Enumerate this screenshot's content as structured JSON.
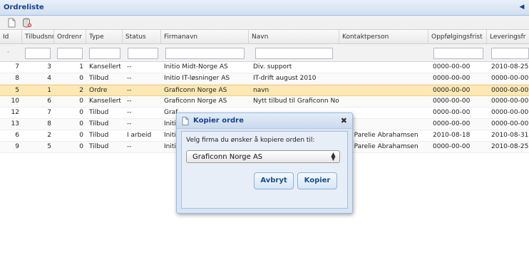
{
  "panel": {
    "title": "Ordreliste",
    "collapse_icon": "chevron-left-icon"
  },
  "toolbar": {
    "icons": [
      "new-document-icon",
      "delete-database-icon"
    ]
  },
  "grid": {
    "columns": [
      "Id",
      "Tilbudsnr",
      "Ordrenr",
      "Type",
      "Status",
      "Firmanavn",
      "Navn",
      "Kontaktperson",
      "Oppfølgingsfrist",
      "Leveringsfr"
    ],
    "filter_placeholder": "-",
    "rows": [
      [
        "7",
        "3",
        "1",
        "Kansellert",
        "--",
        "Initio Midt-Norge AS",
        "Div. support",
        "",
        "0000-00-00",
        "2010-08-25"
      ],
      [
        "8",
        "4",
        "0",
        "Tilbud",
        "--",
        "Initio IT-løsninger AS",
        "IT-drift august 2010",
        "",
        "0000-00-00",
        "0000-00-00"
      ],
      [
        "5",
        "1",
        "2",
        "Ordre",
        "--",
        "Graficonn Norge AS",
        "navn",
        "",
        "0000-00-00",
        "0000-00-00"
      ],
      [
        "10",
        "6",
        "0",
        "Kansellert",
        "--",
        "Graficonn Norge AS",
        "Nytt tilbud til Graficonn Norge",
        "",
        "0000-00-00",
        "0000-00-00"
      ],
      [
        "12",
        "7",
        "0",
        "Tilbud",
        "--",
        "Graf",
        "",
        "",
        "0000-00-00",
        "0000-00-00"
      ],
      [
        "13",
        "8",
        "0",
        "Tilbud",
        "--",
        "Initi",
        "",
        "",
        "0000-00-00",
        "0000-00-00"
      ],
      [
        "6",
        "2",
        "0",
        "Tilbud",
        "I arbeid",
        "Initi",
        "",
        "ith Parelie Abrahamsen",
        "2010-08-18",
        "2010-08-31"
      ],
      [
        "9",
        "5",
        "0",
        "Tilbud",
        "--",
        "Initi",
        "",
        "ith Parelie Abrahamsen",
        "0000-00-00",
        "2010-08-25"
      ]
    ],
    "selected_row": 2
  },
  "dialog": {
    "title": "Kopier ordre",
    "close_label": "✖",
    "prompt": "Velg firma du ønsker å kopiere orden til:",
    "select_value": "Graficonn Norge AS",
    "cancel_label": "Avbryt",
    "ok_label": "Kopier"
  }
}
